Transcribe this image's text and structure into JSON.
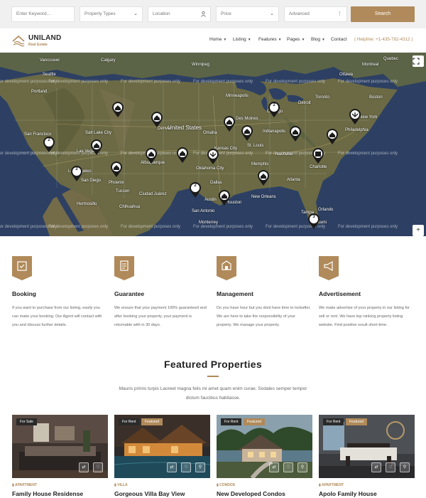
{
  "search": {
    "keyword_placeholder": "Enter Keyword...",
    "property_type": "Property Types",
    "location_placeholder": "Location",
    "price": "Price",
    "advanced": "Advanced",
    "search_label": "Search"
  },
  "header": {
    "logo_title": "UNILAND",
    "logo_subtitle": "Real Estate",
    "nav": [
      {
        "label": "Home"
      },
      {
        "label": "Listing"
      },
      {
        "label": "Features"
      },
      {
        "label": "Pages"
      },
      {
        "label": "Blog"
      },
      {
        "label": "Contact"
      }
    ],
    "helpline": "( Helpline: +1-435-782-4312 )"
  },
  "map": {
    "watermark": "For development purposes only",
    "country_label": "United States",
    "city_labels": [
      "Phoenix",
      "Tucson",
      "Albuquerque",
      "Denver",
      "Dallas",
      "Houston",
      "Austin",
      "Charlotte",
      "Indianapolis",
      "Chicago",
      "Boston",
      "San Diego",
      "Los Angeles",
      "Ciudad Juárez",
      "Monterrey",
      "Ottawa",
      "Montreal",
      "Quebec",
      "Minneapolis",
      "Des Moines",
      "Kansas City",
      "Oklahoma City",
      "Memphis",
      "Atlanta",
      "Philadelphia",
      "New York",
      "Detroit",
      "Toronto",
      "Winnipeg",
      "Calgary",
      "Vancouver",
      "Seattle",
      "Portland",
      "Salt Lake City",
      "Las Vegas",
      "San Francisco",
      "Miami",
      "Orlando",
      "Tampa",
      "New Orleans",
      "San Antonio",
      "Chihuahua",
      "Hermosillo",
      "Omaha",
      "St. Louis",
      "Nashville"
    ],
    "pin_numbers": [
      "2",
      "2",
      "2",
      "2",
      "3"
    ],
    "fullscreen_icon": "fullscreen-icon",
    "zoom_icon": "plus-icon"
  },
  "services": [
    {
      "title": "Booking",
      "text": "If you want to purchase from our listing, easily you can make your booking. Our Agent will contact with you and discuss further details.",
      "icon": "booking-icon"
    },
    {
      "title": "Guarantee",
      "text": "We ensure that your payment 100% guaranteed and after booking your property, your payment is returnable with in 30 days.",
      "icon": "guarantee-icon"
    },
    {
      "title": "Management",
      "text": "Do you have hour but you dont have time to lookafter. We are here to take the responsibility of your property. We manage your property.",
      "icon": "management-icon"
    },
    {
      "title": "Advertisement",
      "text": "We make advertise of your property in our listing for sell or rent. We have top ranking property listing website. Find positive result short-time.",
      "icon": "advertisement-icon"
    }
  ],
  "featured": {
    "title": "Featured Properties",
    "description": "Mauris primis turpis Laoreet magna felis mi amet quam enim curae. Sodales semper tempor dictum faucibus habitasse."
  },
  "cards": [
    {
      "status": "For Sale",
      "featured": "",
      "category": "APARTMENT",
      "title": "Family House Residense"
    },
    {
      "status": "For Rent",
      "featured": "Featured",
      "category": "VILLA",
      "title": "Gorgeous Villa Bay View"
    },
    {
      "status": "For Rent",
      "featured": "Featured",
      "category": "CONDOS",
      "title": "New Developed Condos"
    },
    {
      "status": "For Rent",
      "featured": "Featured",
      "category": "APARTMENT",
      "title": "Apolo Family House"
    }
  ],
  "colors": {
    "accent": "#b08a5a",
    "map_water": "#2d4063",
    "map_land": "#6b6a45"
  }
}
